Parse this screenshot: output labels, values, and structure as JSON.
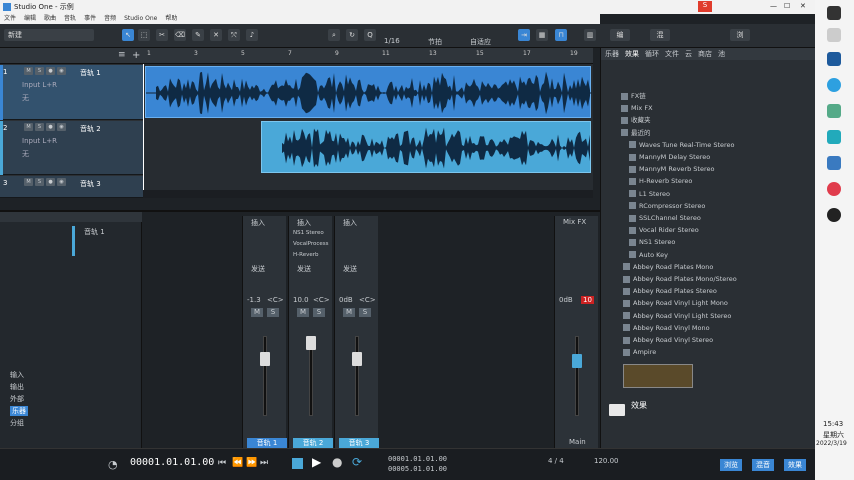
{
  "window": {
    "title": "Studio One - 示例",
    "time": "15:43",
    "weekday": "星期六",
    "date": "2022/3/19"
  },
  "menu": [
    "文件",
    "编辑",
    "歌曲",
    "音轨",
    "事件",
    "音频",
    "Studio One",
    "帮助"
  ],
  "toolbar": {
    "quantize": "1/16",
    "timebase": "节拍",
    "snap": "自适应",
    "track_name_default": "新建"
  },
  "ruler": [
    "1",
    "3",
    "5",
    "7",
    "9",
    "11",
    "13",
    "15",
    "17",
    "19"
  ],
  "tracks": [
    {
      "num": "1",
      "name": "音轨 1",
      "input": "Input L+R",
      "sub": "无",
      "color": "#3a86d4"
    },
    {
      "num": "2",
      "name": "音轨 2",
      "input": "Input L+R",
      "sub": "无",
      "color": "#4aa8d8"
    },
    {
      "num": "3",
      "name": "音轨 3",
      "input": "",
      "sub": "",
      "color": "#4aa8d8"
    }
  ],
  "browser": {
    "tabs": [
      "乐器",
      "效果",
      "循环",
      "文件",
      "云",
      "商店",
      "池"
    ],
    "items": [
      "FX链",
      "Mix FX",
      "收藏夹",
      "最近的",
      "Waves Tune Real-Time Stereo",
      "MannyM Delay Stereo",
      "MannyM Reverb Stereo",
      "H-Reverb Stereo",
      "L1 Stereo",
      "RCompressor Stereo",
      "SSLChannel Stereo",
      "Vocal Rider Stereo",
      "NS1 Stereo",
      "Auto Key",
      "Abbey Road Plates Mono",
      "Abbey Road Plates Mono/Stereo",
      "Abbey Road Plates Stereo",
      "Abbey Road Vinyl Light Mono",
      "Abbey Road Vinyl Light Stereo",
      "Abbey Road Vinyl Mono",
      "Abbey Road Vinyl Stereo",
      "Ampire"
    ],
    "folder": "效果",
    "bottom": [
      "浏览",
      "混音",
      "效果"
    ]
  },
  "mixer": {
    "strips": [
      {
        "db": "-1.3",
        "pan": "<C>",
        "label": "音轨 1",
        "inserts": []
      },
      {
        "db": "10.0",
        "pan": "<C>",
        "label": "音轨 2",
        "inserts": [
          "NS1 Stereo",
          "VocalProcess",
          "H-Reverb"
        ]
      },
      {
        "db": "0dB",
        "pan": "<C>",
        "label": "音轨 3",
        "inserts": []
      }
    ],
    "main": {
      "db": "0dB",
      "peak": "10",
      "label": "Main"
    },
    "inserts_label": "插入",
    "sends_label": "发送",
    "mixfx": "Mix FX",
    "left_list": [
      "音轨 1"
    ],
    "left_buttons": [
      "输入",
      "输出",
      "外部",
      "乐器",
      "分组"
    ]
  },
  "transport": {
    "position": "00001.01.01.00",
    "left": "00001.01.01.00",
    "right": "00005.01.01.00",
    "sig": "4 / 4",
    "tempo": "120.00",
    "key": "节拍"
  }
}
